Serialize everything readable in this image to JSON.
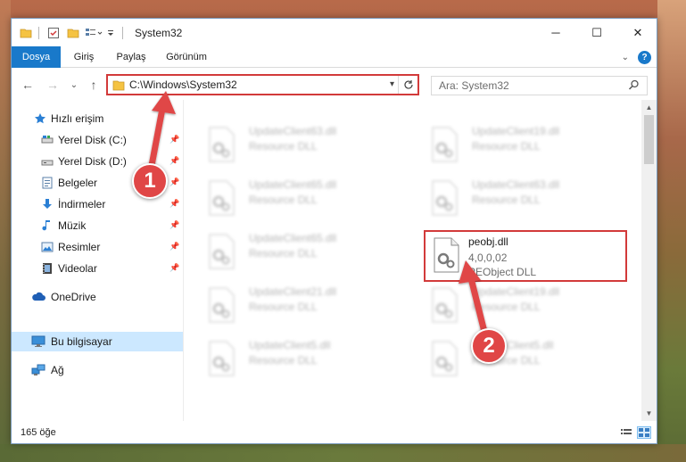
{
  "window": {
    "title": "System32",
    "controls": {
      "minimize": "─",
      "maximize": "☐",
      "close": "✕"
    }
  },
  "ribbon": {
    "tabs": [
      "Dosya",
      "Giriş",
      "Paylaş",
      "Görünüm"
    ],
    "help_label": "?"
  },
  "nav": {
    "back": "←",
    "forward": "→",
    "recent": "⌄",
    "up": "↑",
    "address": "C:\\Windows\\System32",
    "search_placeholder": "Ara: System32"
  },
  "sidebar": {
    "items": [
      {
        "label": "Hızlı erişim",
        "icon": "star-icon",
        "pinned": false
      },
      {
        "label": "Yerel Disk (C:)",
        "icon": "drive-icon",
        "pinned": true
      },
      {
        "label": "Yerel Disk (D:)",
        "icon": "drive-icon",
        "pinned": true
      },
      {
        "label": "Belgeler",
        "icon": "documents-icon",
        "pinned": true
      },
      {
        "label": "İndirmeler",
        "icon": "download-icon",
        "pinned": true
      },
      {
        "label": "Müzik",
        "icon": "music-icon",
        "pinned": true
      },
      {
        "label": "Resimler",
        "icon": "pictures-icon",
        "pinned": true
      },
      {
        "label": "Videolar",
        "icon": "videos-icon",
        "pinned": true
      },
      {
        "label": "OneDrive",
        "icon": "cloud-icon",
        "pinned": false
      },
      {
        "label": "Bu bilgisayar",
        "icon": "computer-icon",
        "pinned": false,
        "selected": true
      },
      {
        "label": "Ağ",
        "icon": "network-icon",
        "pinned": false
      }
    ]
  },
  "files": {
    "left_column": [
      {
        "name": "UpdateClient63.dll",
        "type": "Resource DLL"
      },
      {
        "name": "UpdateClient65.dll",
        "type": "Resource DLL"
      },
      {
        "name": "UpdateClient65.dll",
        "type": "Resource DLL"
      },
      {
        "name": "UpdateClient21.dll",
        "type": "Resource DLL"
      },
      {
        "name": "UpdateClient5.dll",
        "type": "Resource DLL"
      }
    ],
    "right_column": [
      {
        "name": "UpdateClient19.dll",
        "type": "Resource DLL"
      },
      {
        "name": "UpdateClient63.dll",
        "type": "Resource DLL"
      },
      {
        "name": "UpdateClient19.dll",
        "type": "Resource DLL"
      },
      {
        "name": "UpdateClient5.dll",
        "type": "Resource DLL"
      }
    ],
    "highlighted": {
      "name": "peobj.dll",
      "version": "4,0,0,02",
      "type": "PEObject DLL"
    }
  },
  "status": {
    "item_count": "165 öğe"
  },
  "callouts": {
    "first": "1",
    "second": "2"
  },
  "colors": {
    "accent": "#1979ca",
    "highlight": "#d23a3a",
    "callout": "#e04646",
    "selection": "#cce8ff"
  }
}
